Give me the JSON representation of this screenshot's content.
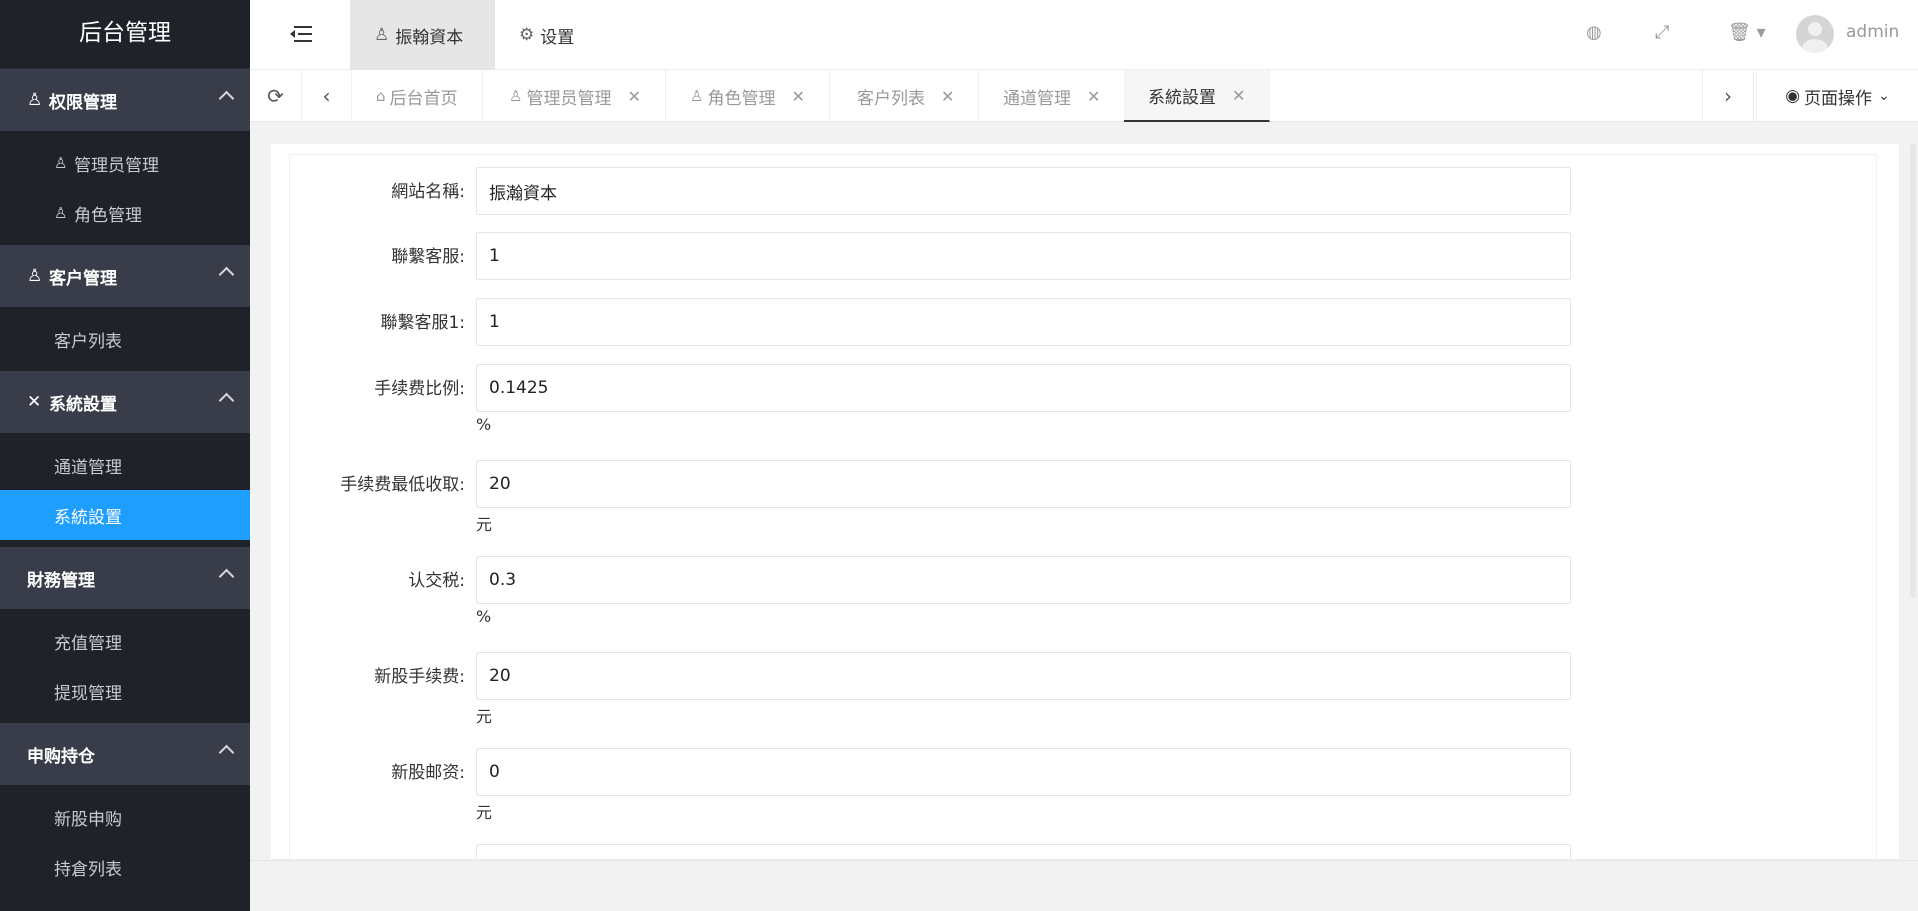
{
  "sidebar": {
    "logo": "后台管理",
    "groups": [
      {
        "label": "权限管理",
        "icon": "user-lock-icon",
        "items": [
          {
            "label": "管理员管理",
            "icon": "user-lock-icon"
          },
          {
            "label": "角色管理",
            "icon": "user-lock-icon"
          }
        ]
      },
      {
        "label": "客户管理",
        "icon": "user-icon",
        "items": [
          {
            "label": "客户列表"
          }
        ]
      },
      {
        "label": "系統設置",
        "icon": "tools-icon",
        "items": [
          {
            "label": "通道管理"
          },
          {
            "label": "系統設置",
            "active": true
          }
        ]
      },
      {
        "label": "財務管理",
        "items": [
          {
            "label": "充值管理"
          },
          {
            "label": "提现管理"
          }
        ]
      },
      {
        "label": "申购持仓",
        "items": [
          {
            "label": "新股申购"
          },
          {
            "label": "持倉列表"
          }
        ]
      }
    ]
  },
  "header": {
    "nav": [
      {
        "label": "振翰資本",
        "icon": "user-icon",
        "active": true
      },
      {
        "label": "设置",
        "icon": "gear-icon"
      }
    ],
    "user": "admin",
    "icons": [
      "globe-icon",
      "fullscreen-icon",
      "trash-icon"
    ]
  },
  "tabs": {
    "items": [
      {
        "label": "后台首页",
        "icon": "home-icon",
        "closable": false
      },
      {
        "label": "管理员管理",
        "icon": "user-lock-icon",
        "closable": true
      },
      {
        "label": "角色管理",
        "icon": "user-lock-icon",
        "closable": true
      },
      {
        "label": "客户列表",
        "closable": true
      },
      {
        "label": "通道管理",
        "closable": true
      },
      {
        "label": "系統設置",
        "closable": true,
        "active": true
      }
    ],
    "page_ops": "页面操作"
  },
  "form": {
    "fields": [
      {
        "label": "網站名稱:",
        "value": "振瀚資本",
        "unit": ""
      },
      {
        "label": "聯繫客服:",
        "value": "1",
        "unit": ""
      },
      {
        "label": "聯繫客服1:",
        "value": "1",
        "unit": ""
      },
      {
        "label": "手续费比例:",
        "value": "0.1425",
        "unit": "%"
      },
      {
        "label": "手续费最低收取:",
        "value": "20",
        "unit": "元"
      },
      {
        "label": "认交税:",
        "value": "0.3",
        "unit": "%"
      },
      {
        "label": "新股手续费:",
        "value": "20",
        "unit": "元"
      },
      {
        "label": "新股邮资:",
        "value": "0",
        "unit": "元"
      }
    ]
  },
  "colors": {
    "sidebar_bg": "#20222a",
    "group_bg": "#393d49",
    "active_blue": "#1e9fff"
  }
}
